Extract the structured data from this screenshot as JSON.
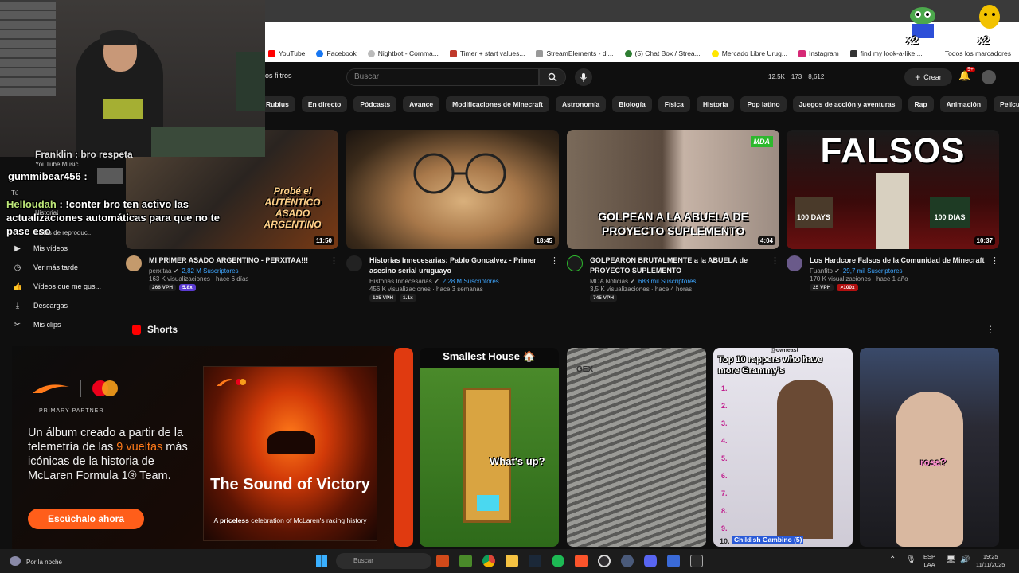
{
  "bookmarks": [
    "YouTube",
    "Facebook",
    "Nightbot - Comma...",
    "Timer + start values...",
    "StreamElements - di...",
    "(5) Chat Box / Strea...",
    "Mercado Libre Urug...",
    "Instagram",
    "find my look-a-like,..."
  ],
  "bookmarks_right": "Todos los marcadores",
  "header": {
    "filters_label": "os filtros",
    "search_placeholder": "Buscar",
    "stats": [
      "12.5K",
      "173",
      "8,612"
    ],
    "create_label": "Crear",
    "notif_count": "9+"
  },
  "chips": [
    "Rubius",
    "En directo",
    "Pódcasts",
    "Avance",
    "Modificaciones de Minecraft",
    "Astronomía",
    "Biología",
    "Física",
    "Historia",
    "Pop latino",
    "Juegos de acción y aventuras",
    "Rap",
    "Animación",
    "Películas de come"
  ],
  "sidebar": {
    "items": [
      {
        "icon": "my-videos-icon",
        "label": "Mis vídeos"
      },
      {
        "icon": "watch-later-icon",
        "label": "Ver más tarde"
      },
      {
        "icon": "liked-videos-icon",
        "label": "Vídeos que me gus..."
      },
      {
        "icon": "downloads-icon",
        "label": "Descargas"
      },
      {
        "icon": "clips-icon",
        "label": "Mis clips"
      }
    ]
  },
  "videos": [
    {
      "title": "MI PRIMER ASADO ARGENTINO - PERXITAA!!!",
      "channel": "perxitaa",
      "subs": "2,82 M Suscriptores",
      "stats": "163 K visualizaciones · hace 6 días",
      "duration": "11:50",
      "thumb_text": "Probé el AUTÉNTICO ASADO ARGENTINO",
      "badges": [
        "266 VPH",
        "5.8x"
      ]
    },
    {
      "title": "Historias Innecesarias: Pablo Goncalvez - Primer asesino serial uruguayo",
      "channel": "Historias Innecesarias",
      "subs": "2,28 M Suscriptores",
      "stats": "456 K visualizaciones · hace 3 semanas",
      "duration": "18:45",
      "thumb_text": "",
      "badges": [
        "135 VPH",
        "1.1x"
      ]
    },
    {
      "title": "GOLPEARON BRUTALMENTE a la ABUELA de PROYECTO SUPLEMENTO",
      "channel": "MDA Noticias",
      "subs": "683 mil Suscriptores",
      "stats": "3,5 K visualizaciones · hace 4 horas",
      "duration": "4:04",
      "thumb_text": "GOLPEAN A LA ABUELA DE PROYECTO SUPLEMENTO",
      "thumb_tag": "MDA",
      "badges": [
        "745 VPH"
      ]
    },
    {
      "title": "Los Hardcore Falsos de la Comunidad de Minecraft",
      "channel": "Fuanfito",
      "subs": "29,7 mil Suscriptores",
      "stats": "170 K visualizaciones · hace 1 año",
      "duration": "10:37",
      "thumb_text": "FALSOS",
      "thumb_sub": [
        "100 DAYS",
        "100 DIAS"
      ],
      "badges": [
        "25 VPH",
        ">100x"
      ]
    }
  ],
  "shorts": {
    "title": "Shorts",
    "items": [
      {
        "caption": "Smallest House 🏠",
        "overlay": "What's up?"
      },
      {
        "caption": "GEX",
        "overlay": ""
      },
      {
        "caption": "Top 10 rappers who have more Grammy's",
        "tag": "@owneast",
        "numbers": [
          "1.",
          "2.",
          "3.",
          "4.",
          "5.",
          "6.",
          "7.",
          "8.",
          "9.",
          "10."
        ],
        "last": "Childish Gambino (5)"
      },
      {
        "caption": "",
        "overlay": "rosa?"
      }
    ]
  },
  "ad": {
    "partner": "PRIMARY PARTNER",
    "text_pre": "Un álbum creado a partir de la telemetría de las ",
    "text_hl": "9 vueltas",
    "text_post": " más icónicas de la historia de McLaren Formula 1® Team.",
    "cta": "Escúchalo ahora",
    "album_title": "The Sound of Victory",
    "album_sub_pre": "A ",
    "album_sub_bold": "priceless",
    "album_sub_post": " celebration of McLaren's racing history"
  },
  "chat": {
    "line0": "Franklin : bro respeta",
    "user1": "gummibear456 :",
    "user2": "Helloudah",
    "msg2": ": !conter bro ten activo las actualizaciones automáticas para que no te pase eso",
    "yt_music": "YouTube Music",
    "tu": "Tú",
    "historial": "Historial",
    "listas": "Listas de reproduc..."
  },
  "taskbar": {
    "weather": "Por la noche",
    "search": "Buscar",
    "lang": "ESP",
    "lang2": "LAA",
    "time": "19:25",
    "date": "11/11/2025"
  },
  "overlay_badges": [
    "x2",
    "x2"
  ]
}
